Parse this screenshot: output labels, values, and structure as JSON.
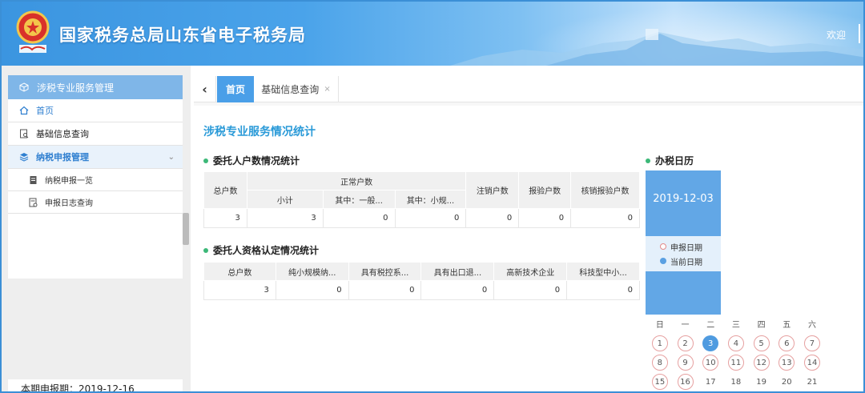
{
  "header": {
    "title": "国家税务总局山东省电子税务局",
    "welcome": "欢迎"
  },
  "sidebar": {
    "panel_title": "涉税专业服务管理",
    "items": [
      {
        "label": "首页",
        "icon": "home-icon"
      },
      {
        "label": "基础信息查询",
        "icon": "search-doc-icon"
      },
      {
        "label": "纳税申报管理",
        "icon": "layers-icon"
      },
      {
        "label": "纳税申报一览",
        "icon": "doc-icon"
      },
      {
        "label": "申报日志查询",
        "icon": "log-icon"
      }
    ],
    "period_label": "本期申报期：",
    "period_value": "2019-12-16"
  },
  "tabs": {
    "home": "首页",
    "info": "基础信息查询",
    "close": "×"
  },
  "main": {
    "page_title": "涉税专业服务情况统计",
    "table1": {
      "title": "委托人户数情况统计",
      "headers": {
        "total": "总户数",
        "normal": "正常户数",
        "subtotal": "小计",
        "general": "其中：一般...",
        "small": "其中：小规...",
        "cancelled": "注销户数",
        "inspected": "报验户数",
        "cancel_inspected": "核销报验户数"
      },
      "row": [
        "3",
        "3",
        "0",
        "0",
        "0",
        "0",
        "0"
      ]
    },
    "table2": {
      "title": "委托人资格认定情况统计",
      "headers": [
        "总户数",
        "纯小规模纳...",
        "具有税控系...",
        "具有出口退...",
        "高新技术企业",
        "科技型中小..."
      ],
      "row": [
        "3",
        "0",
        "0",
        "0",
        "0",
        "0"
      ]
    }
  },
  "calendar": {
    "title": "办税日历",
    "date": "2019-12-03",
    "legend_declare": "申报日期",
    "legend_current": "当前日期",
    "weekdays": [
      "日",
      "一",
      "二",
      "三",
      "四",
      "五",
      "六"
    ],
    "days": [
      "1",
      "2",
      "3",
      "4",
      "5",
      "6",
      "7",
      "8",
      "9",
      "10",
      "11",
      "12",
      "13",
      "14",
      "15",
      "16",
      "17",
      "18",
      "19",
      "20",
      "21"
    ],
    "ringed_days": [
      "1",
      "2",
      "4",
      "5",
      "6",
      "7",
      "8",
      "9",
      "10",
      "11",
      "12",
      "13",
      "14",
      "15",
      "16"
    ],
    "today": "3",
    "colors": {
      "accent": "#62a7e6",
      "today": "#4f9be0",
      "ring": "#e6a0a0"
    }
  }
}
